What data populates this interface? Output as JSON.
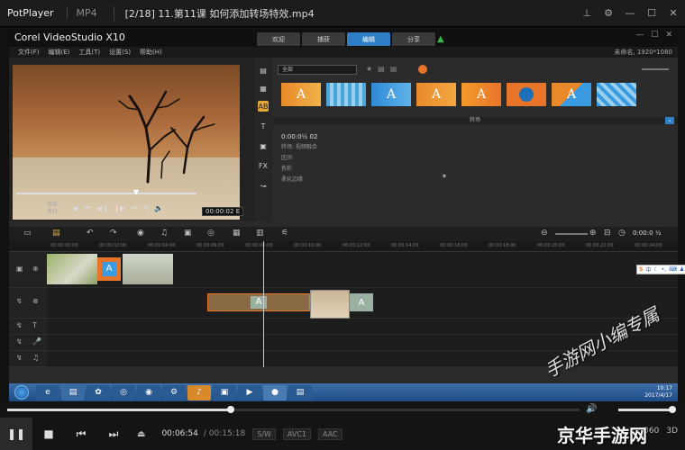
{
  "potplayer": {
    "brand": "PotPlayer",
    "format": "MP4",
    "file_title": "[2/18] 11.第11课 如何添加转场特效.mp4",
    "win_buttons": [
      "pin-icon",
      "settings-icon",
      "minimize-icon",
      "maximize-icon",
      "close-icon"
    ],
    "current_time": "00:06:54",
    "total_time": "/ 00:15:18",
    "badges": [
      "S/W",
      "AVC1",
      "AAC"
    ],
    "progress": 0.39,
    "volume": 0.9,
    "right_controls": [
      "360",
      "3D"
    ]
  },
  "videostudio": {
    "logo": "Corel VideoStudio X10",
    "tabs": [
      "欢迎",
      "捕获",
      "编辑",
      "分享"
    ],
    "active_tab": "编辑",
    "menu": [
      "文件(F)",
      "编辑(E)",
      "工具(T)",
      "设置(S)",
      "帮助(H)"
    ],
    "project_info": "未命名, 1920*1080",
    "player": {
      "label_project": "项目",
      "label_clip": "素材",
      "timecode": "00:00:02",
      "timecode_suffix": "E"
    },
    "library": {
      "category": "全部",
      "section_label": "转场",
      "duration": "0:00:0½ 02",
      "options": [
        "区间",
        "色彩",
        "柔化边缘"
      ],
      "option_title": "转场: 视频融合"
    },
    "timeline": {
      "time": "0:00:0 ½",
      "ruler": [
        "00:00:00:00",
        "00:00:02:00",
        "00:00:04:00",
        "00:00:06:00",
        "00:00:08:00",
        "00:00:10:00",
        "00:00:12:00",
        "00:00:14:00",
        "00:00:16:00",
        "00:00:18:00",
        "00:00:20:00",
        "00:00:22:00",
        "00:00:24:00"
      ]
    }
  },
  "taskbar": {
    "time": "10:17",
    "date": "2017/4/17"
  },
  "watermark": {
    "handwriting": "手游网小编专属",
    "brand": "京华手游网"
  },
  "colors": {
    "accent_blue": "#2f7fc6",
    "orange": "#e8742a",
    "vs_bg": "#2b2b2b"
  }
}
